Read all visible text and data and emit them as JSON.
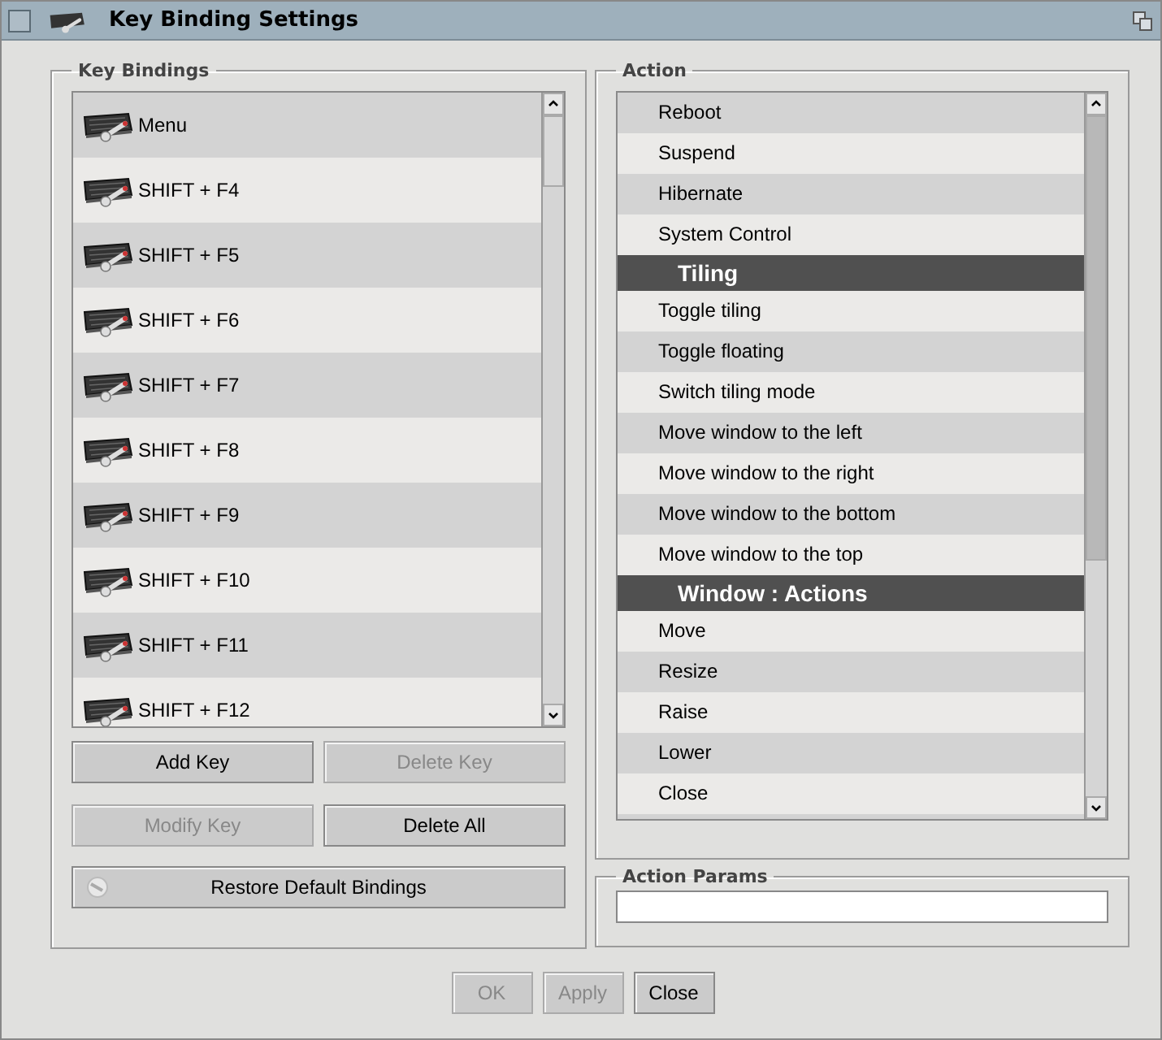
{
  "window": {
    "title": "Key Binding Settings"
  },
  "key_bindings": {
    "title": "Key Bindings",
    "items": [
      {
        "label": "Menu"
      },
      {
        "label": "SHIFT + F4"
      },
      {
        "label": "SHIFT + F5"
      },
      {
        "label": "SHIFT + F6"
      },
      {
        "label": "SHIFT + F7"
      },
      {
        "label": "SHIFT + F8"
      },
      {
        "label": "SHIFT + F9"
      },
      {
        "label": "SHIFT + F10"
      },
      {
        "label": "SHIFT + F11"
      },
      {
        "label": "SHIFT + F12"
      }
    ],
    "buttons": [
      {
        "label": "Add Key",
        "disabled": false
      },
      {
        "label": "Delete Key",
        "disabled": true
      },
      {
        "label": "Modify Key",
        "disabled": true
      },
      {
        "label": "Delete All",
        "disabled": false
      }
    ],
    "restore_button": {
      "label": "Restore Default Bindings",
      "disabled": false
    }
  },
  "action": {
    "title": "Action",
    "items": [
      {
        "kind": "action",
        "label": "Reboot"
      },
      {
        "kind": "action",
        "label": "Suspend"
      },
      {
        "kind": "action",
        "label": "Hibernate"
      },
      {
        "kind": "action",
        "label": "System Control"
      },
      {
        "kind": "header",
        "label": "Tiling"
      },
      {
        "kind": "action",
        "label": "Toggle tiling"
      },
      {
        "kind": "action",
        "label": "Toggle floating"
      },
      {
        "kind": "action",
        "label": "Switch tiling mode"
      },
      {
        "kind": "action",
        "label": "Move window to the left"
      },
      {
        "kind": "action",
        "label": "Move window to the right"
      },
      {
        "kind": "action",
        "label": "Move window to the bottom"
      },
      {
        "kind": "action",
        "label": "Move window to the top"
      },
      {
        "kind": "header",
        "label": "Window : Actions"
      },
      {
        "kind": "action",
        "label": "Move"
      },
      {
        "kind": "action",
        "label": "Resize"
      },
      {
        "kind": "action",
        "label": "Raise"
      },
      {
        "kind": "action",
        "label": "Lower"
      },
      {
        "kind": "action",
        "label": "Close"
      }
    ]
  },
  "action_params": {
    "title": "Action Params"
  },
  "dialog_buttons": [
    {
      "label": "OK",
      "disabled": true
    },
    {
      "label": "Apply",
      "disabled": true
    },
    {
      "label": "Close",
      "disabled": false
    }
  ]
}
